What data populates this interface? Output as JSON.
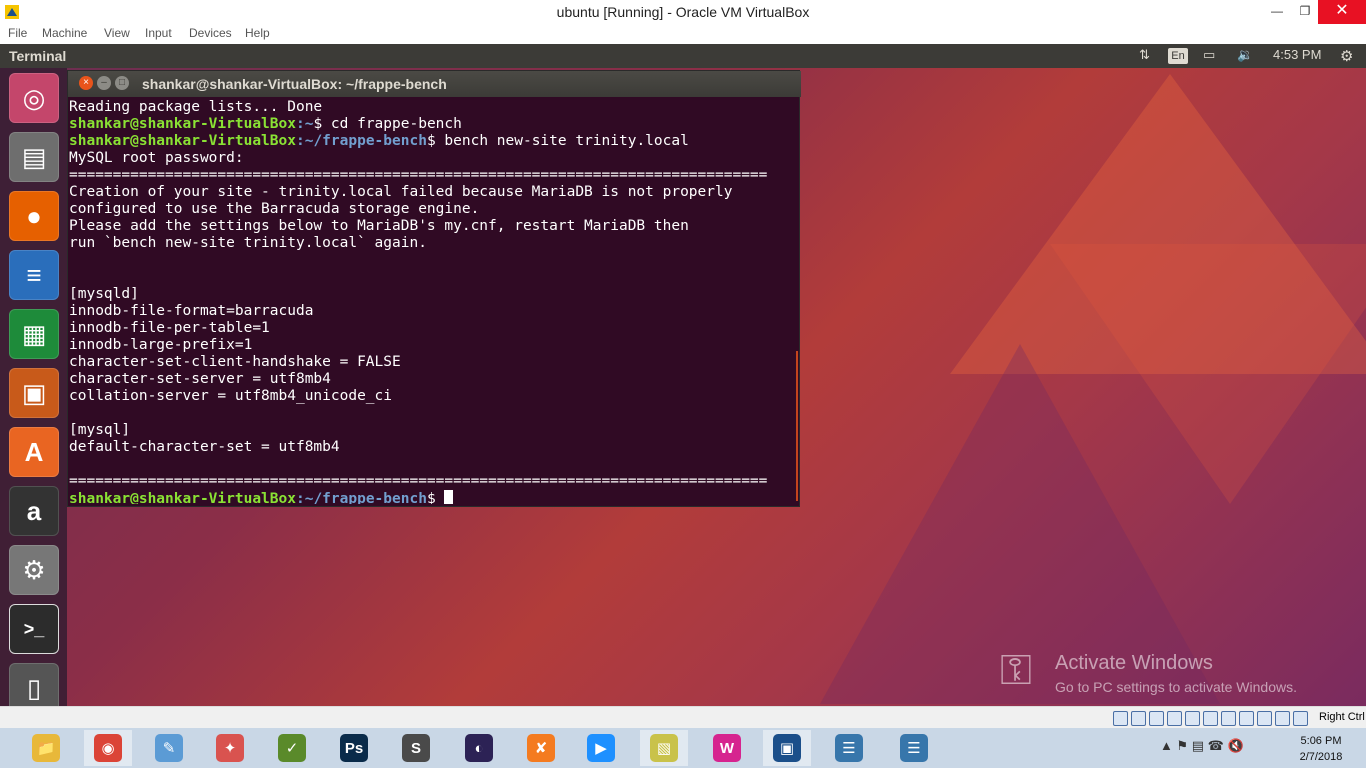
{
  "host_window": {
    "title": "ubuntu [Running] - Oracle VM VirtualBox",
    "minimize": "—",
    "maximize": "❐",
    "close": "✕"
  },
  "vbox_menu": [
    "File",
    "Machine",
    "View",
    "Input",
    "Devices",
    "Help"
  ],
  "ubuntu_panel": {
    "app_name": "Terminal",
    "keyboard_icon": "⇅",
    "language": "En",
    "battery_icon": "▭",
    "volume_icon": "🔉",
    "time": "4:53 PM",
    "settings_icon": "⚙"
  },
  "launcher": [
    {
      "name": "ubuntu-dash",
      "glyph": "◎",
      "bg": "#c4466b"
    },
    {
      "name": "files",
      "glyph": "▤",
      "bg": "#6e6e6e"
    },
    {
      "name": "firefox",
      "glyph": "●",
      "bg": "#e66000"
    },
    {
      "name": "libreoffice-writer",
      "glyph": "≡",
      "bg": "#2a6ebb"
    },
    {
      "name": "libreoffice-calc",
      "glyph": "▦",
      "bg": "#1e8b3a"
    },
    {
      "name": "libreoffice-impress",
      "glyph": "▣",
      "bg": "#c85a1a"
    },
    {
      "name": "software-center",
      "glyph": "A",
      "bg": "#e96522"
    },
    {
      "name": "amazon",
      "glyph": "a",
      "bg": "#333333"
    },
    {
      "name": "system-settings",
      "glyph": "⚙",
      "bg": "#777777"
    },
    {
      "name": "terminal",
      "glyph": ">_",
      "bg": "#2c2c2c"
    },
    {
      "name": "trash",
      "glyph": "▯",
      "bg": "#555555"
    }
  ],
  "terminal": {
    "title": "shankar@shankar-VirtualBox: ~/frappe-bench",
    "close": "×",
    "minimize": "–",
    "maximize": "□",
    "prompt_user": "shankar@shankar-VirtualBox",
    "lines": [
      {
        "text": "Reading package lists... Done"
      },
      {
        "prompt_user": "shankar@shankar-VirtualBox",
        "path": ":~",
        "cmd": "$ cd frappe-bench"
      },
      {
        "prompt_user": "shankar@shankar-VirtualBox",
        "path": ":~/frappe-bench",
        "cmd": "$ bench new-site trinity.local"
      },
      {
        "text": "MySQL root password: "
      },
      {
        "text": "================================================================================"
      },
      {
        "text": "Creation of your site - trinity.local failed because MariaDB is not properly "
      },
      {
        "text": "configured to use the Barracuda storage engine."
      },
      {
        "text": "Please add the settings below to MariaDB's my.cnf, restart MariaDB then"
      },
      {
        "text": "run `bench new-site trinity.local` again."
      },
      {
        "text": ""
      },
      {
        "text": ""
      },
      {
        "text": "[mysqld]"
      },
      {
        "text": "innodb-file-format=barracuda"
      },
      {
        "text": "innodb-file-per-table=1"
      },
      {
        "text": "innodb-large-prefix=1"
      },
      {
        "text": "character-set-client-handshake = FALSE"
      },
      {
        "text": "character-set-server = utf8mb4"
      },
      {
        "text": "collation-server = utf8mb4_unicode_ci"
      },
      {
        "text": ""
      },
      {
        "text": "[mysql]"
      },
      {
        "text": "default-character-set = utf8mb4"
      },
      {
        "text": ""
      },
      {
        "text": "================================================================================"
      },
      {
        "prompt_user": "shankar@shankar-VirtualBox",
        "path": ":~/frappe-bench",
        "cmd": "$ ",
        "cursor": true
      }
    ]
  },
  "watermark": {
    "key_icon": "⚿",
    "line1": "Activate Windows",
    "line2": "Go to PC settings to activate Windows."
  },
  "vbox_status": {
    "host_key": "Right Ctrl"
  },
  "taskbar": {
    "apps": [
      {
        "name": "file-explorer",
        "glyph": "📁",
        "bg": "#e8b83a"
      },
      {
        "name": "chrome",
        "glyph": "◉",
        "bg": "#db4437"
      },
      {
        "name": "notepad",
        "glyph": "✎",
        "bg": "#5b9bd5"
      },
      {
        "name": "app-red",
        "glyph": "✦",
        "bg": "#d9534f"
      },
      {
        "name": "app-green",
        "glyph": "✓",
        "bg": "#5a8a2a"
      },
      {
        "name": "photoshop",
        "glyph": "Ps",
        "bg": "#0a2b4a"
      },
      {
        "name": "sublime-text",
        "glyph": "S",
        "bg": "#4a4a4a"
      },
      {
        "name": "eclipse",
        "glyph": "◐",
        "bg": "#2c2255"
      },
      {
        "name": "xampp",
        "glyph": "✘",
        "bg": "#f47b20"
      },
      {
        "name": "media-player",
        "glyph": "▶",
        "bg": "#1e90ff"
      },
      {
        "name": "sticky-notes",
        "glyph": "▧",
        "bg": "#c9c24a"
      },
      {
        "name": "wampserver",
        "glyph": "W",
        "bg": "#d6248f"
      },
      {
        "name": "virtualbox",
        "glyph": "▣",
        "bg": "#1b4f8a"
      },
      {
        "name": "python-idle",
        "glyph": "☰",
        "bg": "#3776ab"
      },
      {
        "name": "python",
        "glyph": "☰",
        "bg": "#3776ab"
      }
    ],
    "tray_icons": "▲  ⚑  ▤  ☎  🔇",
    "time": "5:06 PM",
    "date": "2/7/2018"
  }
}
